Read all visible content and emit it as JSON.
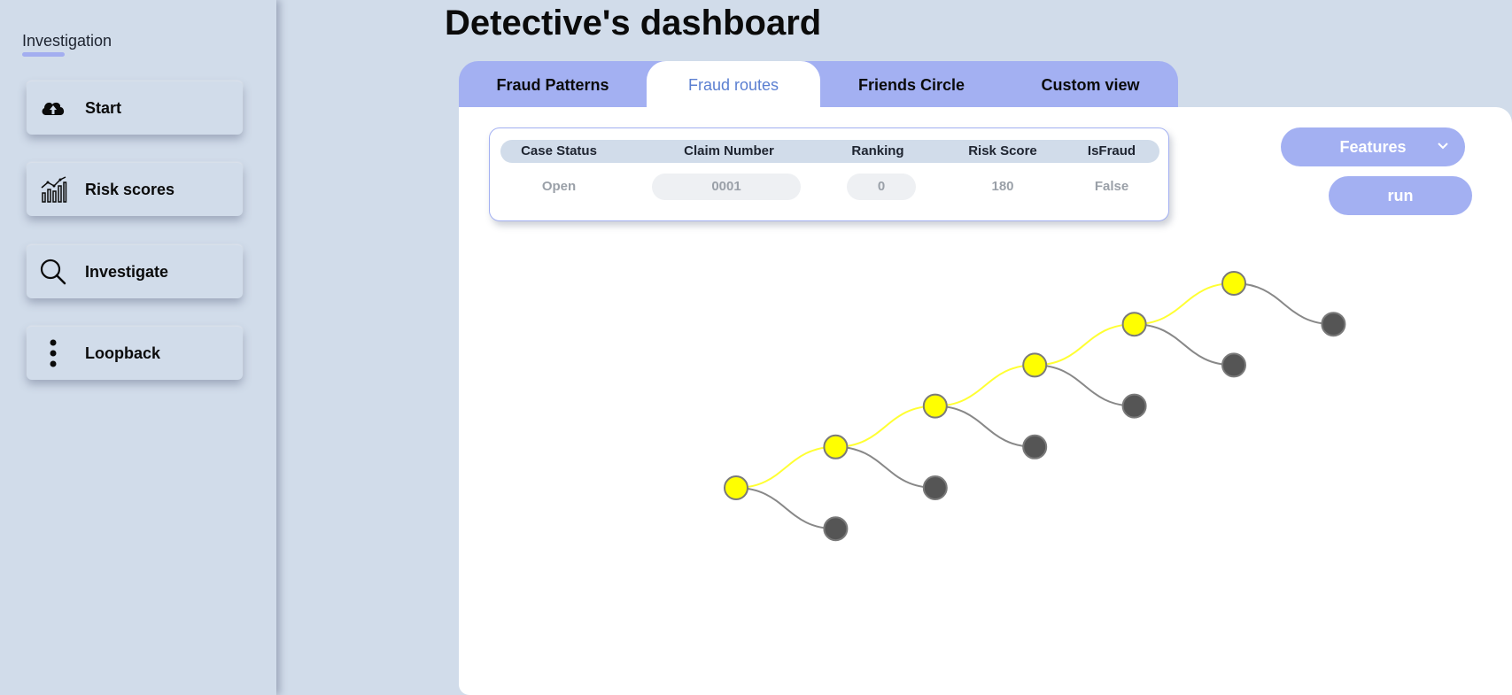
{
  "sidebar": {
    "title": "Investigation",
    "items": [
      {
        "label": "Start",
        "icon": "cloud-upload-icon"
      },
      {
        "label": "Risk scores",
        "icon": "bar-chart-icon"
      },
      {
        "label": "Investigate",
        "icon": "search-icon"
      },
      {
        "label": "Loopback",
        "icon": "vertical-dots-icon"
      }
    ]
  },
  "header": {
    "title": "Detective's dashboard"
  },
  "tabs": [
    {
      "label": "Fraud Patterns",
      "active": false
    },
    {
      "label": "Fraud routes",
      "active": true
    },
    {
      "label": "Friends Circle",
      "active": false
    },
    {
      "label": "Custom view",
      "active": false
    }
  ],
  "info_card": {
    "headers": [
      "Case Status",
      "Claim Number",
      "Ranking",
      "Risk Score",
      "IsFraud"
    ],
    "values": [
      "Open",
      "0001",
      "0",
      "180",
      "False"
    ]
  },
  "controls": {
    "features_label": "Features",
    "run_label": "run"
  },
  "colors": {
    "background": "#d1dcea",
    "accent": "#a3b0f2",
    "active_tab_text": "#5b7fd1",
    "route_node": "#ffff00",
    "route_edge": "#ffff33",
    "branch_node": "#555555",
    "branch_edge": "#888888"
  },
  "graph": {
    "route_nodes": 6,
    "branch_nodes": 6
  }
}
